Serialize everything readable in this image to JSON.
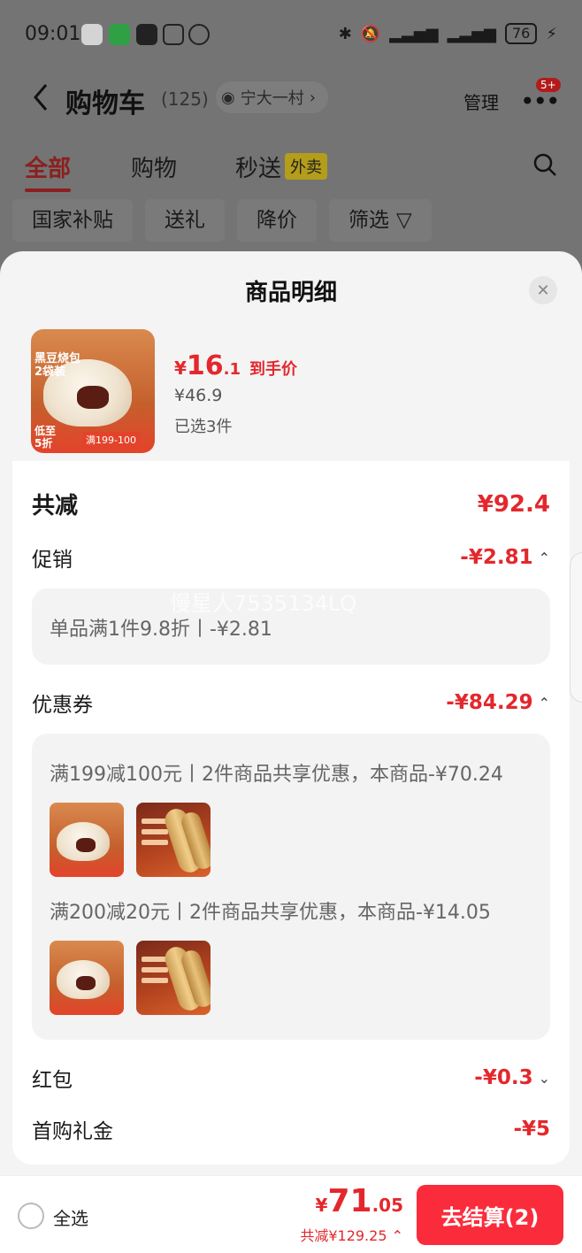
{
  "status_bar": {
    "time": "09:01",
    "battery": "76"
  },
  "nav": {
    "title": "购物车",
    "count": "(125)",
    "location": "宁大一村",
    "manage": "管理",
    "more_badge": "5+"
  },
  "tabs": [
    {
      "label": "全部"
    },
    {
      "label": "购物"
    },
    {
      "label": "秒送",
      "badge": "外卖"
    }
  ],
  "filters": [
    "国家补贴",
    "送礼",
    "降价",
    "筛选"
  ],
  "sheet": {
    "title": "商品明细",
    "product": {
      "image_text_1": "黑豆烧包\n2袋装",
      "image_text_2": "低至\n5折",
      "image_text_3": "满199-100",
      "price_currency": "¥",
      "price_int": "16",
      "price_dec": ".1",
      "price_tag": "到手价",
      "original_price": "¥46.9",
      "selected": "已选3件"
    },
    "total": {
      "label": "共减",
      "value": "¥92.4"
    },
    "promotion": {
      "label": "促销",
      "value": "-¥2.81",
      "detail": "单品满1件9.8折丨-¥2.81"
    },
    "coupon": {
      "label": "优惠券",
      "value": "-¥84.29",
      "items": [
        {
          "text": "满199减100元丨2件商品共享优惠，本商品-¥70.24"
        },
        {
          "text": "满200减20元丨2件商品共享优惠，本商品-¥14.05"
        }
      ]
    },
    "redpacket": {
      "label": "红包",
      "value": "-¥0.3"
    },
    "first_gift": {
      "label": "首购礼金",
      "value": "-¥5"
    },
    "watermark": "慢星人7535134LQ"
  },
  "bottom": {
    "select_all": "全选",
    "pay_currency": "¥",
    "pay_int": "71",
    "pay_dec": ".05",
    "saved": "共减¥129.25",
    "checkout": "去结算(2)"
  },
  "colors": {
    "accent": "#e3282d",
    "checkout_bg": "#fa2c3b",
    "overlay": "#747474"
  }
}
